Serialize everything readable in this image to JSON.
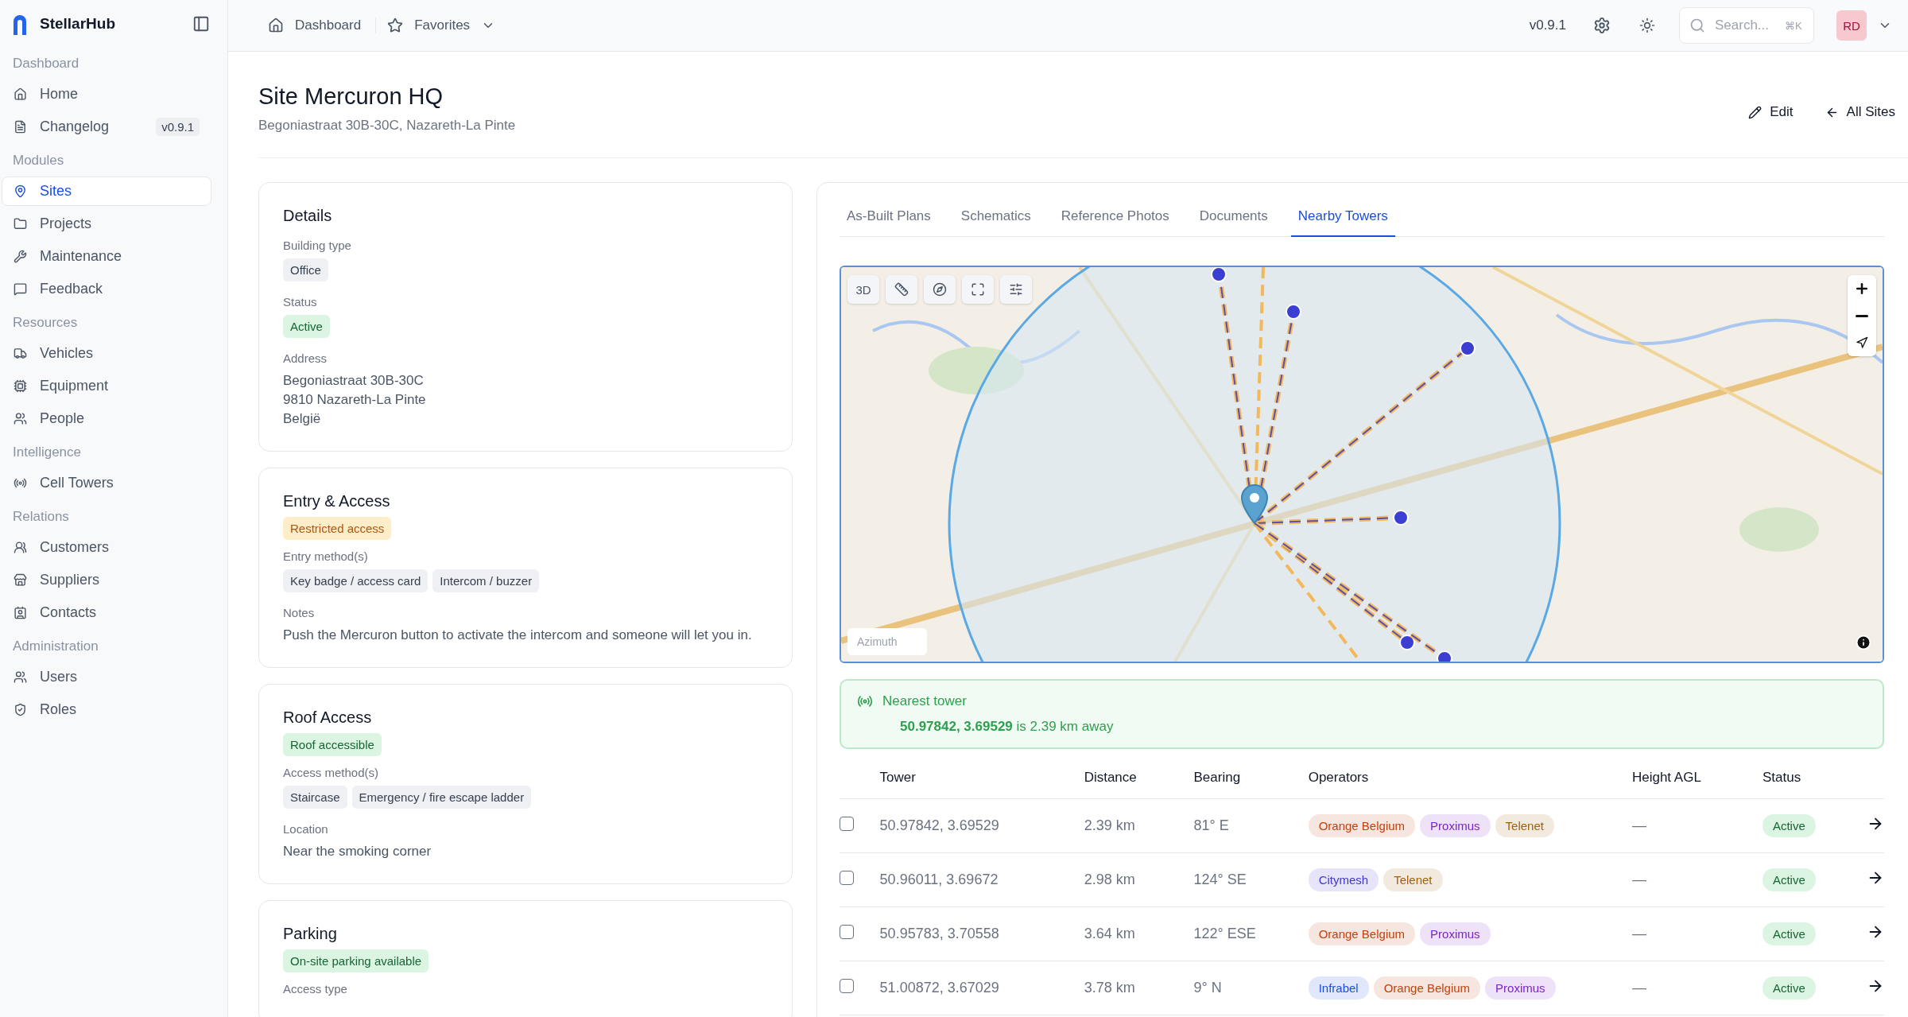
{
  "sidebar": {
    "brand": "StellarHub",
    "sections": [
      {
        "heading": "Dashboard",
        "items": [
          {
            "label": "Home",
            "selected": false
          },
          {
            "label": "Changelog",
            "selected": false,
            "badge": "v0.9.1"
          }
        ]
      },
      {
        "heading": "Modules",
        "items": [
          {
            "label": "Sites",
            "selected": true
          },
          {
            "label": "Projects",
            "selected": false
          },
          {
            "label": "Maintenance",
            "selected": false
          },
          {
            "label": "Feedback",
            "selected": false
          }
        ]
      },
      {
        "heading": "Resources",
        "items": [
          {
            "label": "Vehicles",
            "selected": false
          },
          {
            "label": "Equipment",
            "selected": false
          },
          {
            "label": "People",
            "selected": false
          }
        ]
      },
      {
        "heading": "Intelligence",
        "items": [
          {
            "label": "Cell Towers",
            "selected": false
          }
        ]
      },
      {
        "heading": "Relations",
        "items": [
          {
            "label": "Customers",
            "selected": false
          },
          {
            "label": "Suppliers",
            "selected": false
          },
          {
            "label": "Contacts",
            "selected": false
          }
        ]
      },
      {
        "heading": "Administration",
        "items": [
          {
            "label": "Users",
            "selected": false
          },
          {
            "label": "Roles",
            "selected": false
          }
        ]
      }
    ]
  },
  "topbar": {
    "breadcrumbs": [
      "Dashboard",
      "Favorites"
    ],
    "version": "v0.9.1",
    "search": {
      "placeholder": "Search...",
      "shortcut": "⌘K"
    },
    "avatar": "RD"
  },
  "header": {
    "title": "Site Mercuron HQ",
    "subtitle": "Begoniastraat 30B-30C, Nazareth-La Pinte",
    "actions": [
      "Edit",
      "All Sites"
    ]
  },
  "cards": [
    {
      "title": "Details",
      "fields": [
        {
          "label": "Building type",
          "tags": [
            {
              "text": "Office",
              "kind": "neutral"
            }
          ]
        },
        {
          "label": "Status",
          "tags": [
            {
              "text": "Active",
              "kind": "success"
            }
          ]
        },
        {
          "label": "Address",
          "lines": [
            "Begoniastraat 30B-30C",
            "9810 Nazareth-La Pinte",
            "België"
          ]
        }
      ]
    },
    {
      "title": "Entry & Access",
      "badge": {
        "text": "Restricted access",
        "kind": "warning"
      },
      "fields": [
        {
          "label": "Entry method(s)",
          "tags": [
            {
              "text": "Key badge / access card",
              "kind": "neutral"
            },
            {
              "text": "Intercom / buzzer",
              "kind": "neutral"
            }
          ]
        },
        {
          "label": "Notes",
          "lines": [
            "Push the Mercuron button to activate the intercom and someone will let you in."
          ]
        }
      ]
    },
    {
      "title": "Roof Access",
      "badge": {
        "text": "Roof accessible",
        "kind": "success"
      },
      "fields": [
        {
          "label": "Access method(s)",
          "tags": [
            {
              "text": "Staircase",
              "kind": "neutral"
            },
            {
              "text": "Emergency / fire escape ladder",
              "kind": "neutral"
            }
          ]
        },
        {
          "label": "Location",
          "lines": [
            "Near the smoking corner"
          ]
        }
      ]
    },
    {
      "title": "Parking",
      "badge": {
        "text": "On-site parking available",
        "kind": "success"
      },
      "fields": [
        {
          "label": "Access type"
        }
      ]
    }
  ],
  "tabs": [
    {
      "label": "As-Built Plans",
      "selected": false
    },
    {
      "label": "Schematics",
      "selected": false
    },
    {
      "label": "Reference Photos",
      "selected": false
    },
    {
      "label": "Documents",
      "selected": false
    },
    {
      "label": "Nearby Towers",
      "selected": true
    }
  ],
  "map": {
    "mode_button": "3D",
    "azimuth_placeholder": "Azimuth"
  },
  "nearest": {
    "title": "Nearest tower",
    "text": "**50.97842, 3.69529** is 2.39 km away"
  },
  "table": {
    "columns": [
      "Tower",
      "Distance",
      "Bearing",
      "Operators",
      "Height AGL",
      "Status"
    ],
    "rows": [
      {
        "checked": false,
        "tower": "50.97842, 3.69529",
        "distance": "2.39 km",
        "bearing": "81° E",
        "operators": [
          {
            "name": "Orange Belgium",
            "color": "#c2410c"
          },
          {
            "name": "Proximus",
            "color": "#7e22ce"
          },
          {
            "name": "Telenet",
            "color": "#a16207"
          }
        ],
        "height": "—",
        "status": "Active"
      },
      {
        "checked": false,
        "tower": "50.96011, 3.69672",
        "distance": "2.98 km",
        "bearing": "124° SE",
        "operators": [
          {
            "name": "Citymesh",
            "color": "#4338ca"
          },
          {
            "name": "Telenet",
            "color": "#a16207"
          }
        ],
        "height": "—",
        "status": "Active"
      },
      {
        "checked": false,
        "tower": "50.95783, 3.70558",
        "distance": "3.64 km",
        "bearing": "122° ESE",
        "operators": [
          {
            "name": "Orange Belgium",
            "color": "#c2410c"
          },
          {
            "name": "Proximus",
            "color": "#7e22ce"
          }
        ],
        "height": "—",
        "status": "Active"
      },
      {
        "checked": false,
        "tower": "51.00872, 3.67029",
        "distance": "3.78 km",
        "bearing": "9° N",
        "operators": [
          {
            "name": "Infrabel",
            "color": "#1d4ed8"
          },
          {
            "name": "Orange Belgium",
            "color": "#c2410c"
          },
          {
            "name": "Proximus",
            "color": "#7e22ce"
          }
        ],
        "height": "—",
        "status": "Active"
      }
    ]
  }
}
